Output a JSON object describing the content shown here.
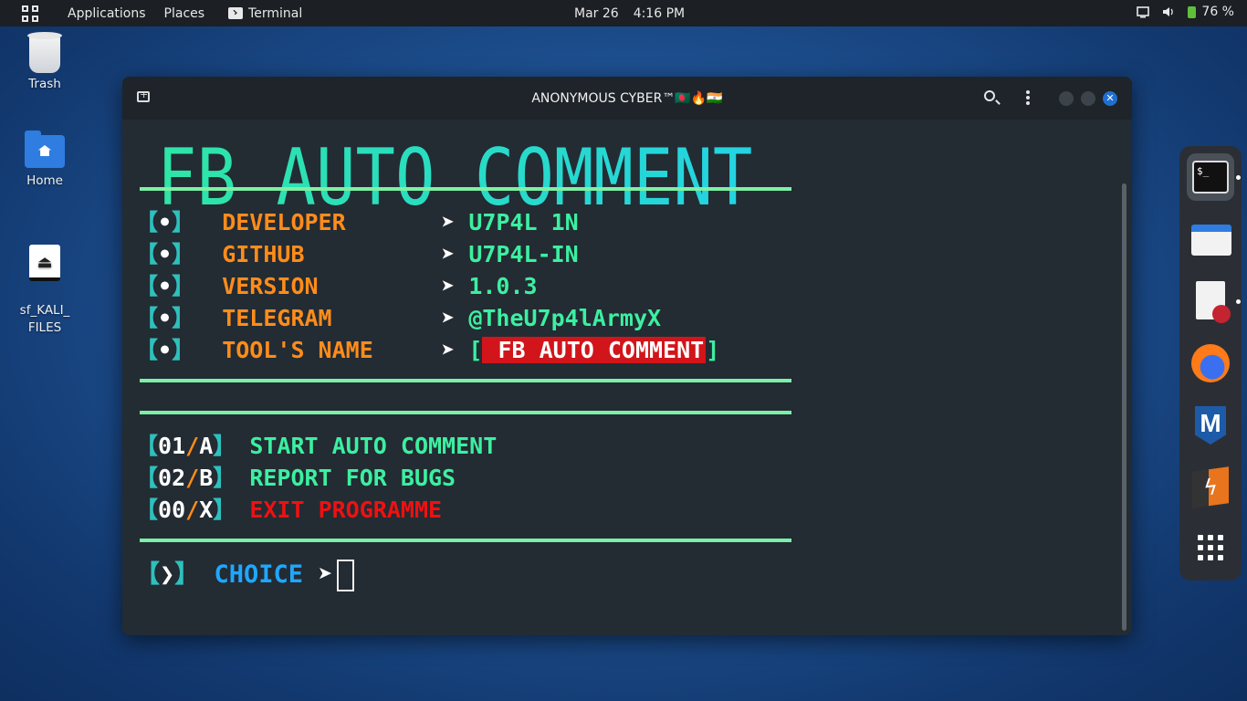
{
  "topbar": {
    "applications": "Applications",
    "places": "Places",
    "active_app": "Terminal",
    "date": "Mar 26",
    "time": "4:16 PM",
    "battery": "76 %"
  },
  "desktop": {
    "icons": [
      {
        "label": "Trash"
      },
      {
        "label": "Home"
      },
      {
        "label": "sf_KALI_\nFILES"
      }
    ]
  },
  "window": {
    "title": "ANONYMOUS CYBER™🇧🇩🔥🇮🇳"
  },
  "terminal": {
    "banner": "FB AUTO COMMENT",
    "info": [
      {
        "bracket_l": "【",
        "dot": "•",
        "bracket_r": "】",
        "label": "DEVELOPER",
        "arrow": "➤",
        "value": "U7P4L 1N"
      },
      {
        "bracket_l": "【",
        "dot": "•",
        "bracket_r": "】",
        "label": "GITHUB",
        "arrow": "➤",
        "value": "U7P4L-IN"
      },
      {
        "bracket_l": "【",
        "dot": "•",
        "bracket_r": "】",
        "label": "VERSION",
        "arrow": "➤",
        "value": "1.0.3"
      },
      {
        "bracket_l": "【",
        "dot": "•",
        "bracket_r": "】",
        "label": "TELEGRAM",
        "arrow": "➤",
        "value": "@TheU7p4lArmyX"
      }
    ],
    "toolname": {
      "bracket_l": "【",
      "dot": "•",
      "bracket_r": "】",
      "label": "TOOL'S NAME",
      "arrow": "➤",
      "open": "[",
      "value": " FB AUTO COMMENT",
      "close": "]"
    },
    "options": [
      {
        "bracket_l": "【",
        "num": "01",
        "slash": "/",
        "key": "A",
        "bracket_r": "】",
        "label": "START AUTO COMMENT"
      },
      {
        "bracket_l": "【",
        "num": "02",
        "slash": "/",
        "key": "B",
        "bracket_r": "】",
        "label": "REPORT FOR BUGS"
      },
      {
        "bracket_l": "【",
        "num": "00",
        "slash": "/",
        "key": "X",
        "bracket_r": "】",
        "label": "EXIT PROGRAMME"
      }
    ],
    "prompt": {
      "bracket_l": "【",
      "chev": "❯",
      "bracket_r": "】",
      "label": "CHOICE",
      "arrow": "➤"
    }
  },
  "dock": {
    "items": [
      "terminal-icon",
      "files-icon",
      "text-editor-icon",
      "firefox-icon",
      "metasploit-icon",
      "burpsuite-icon",
      "app-grid-icon"
    ],
    "terminal_glyph": "$_"
  },
  "colors": {
    "label": "#ff8c1a",
    "value": "#3bf0a0",
    "bracket": "#2fc0bd",
    "choice": "#1fa7ff",
    "exit": "#ee1111",
    "rule": "#7cf0a6"
  }
}
